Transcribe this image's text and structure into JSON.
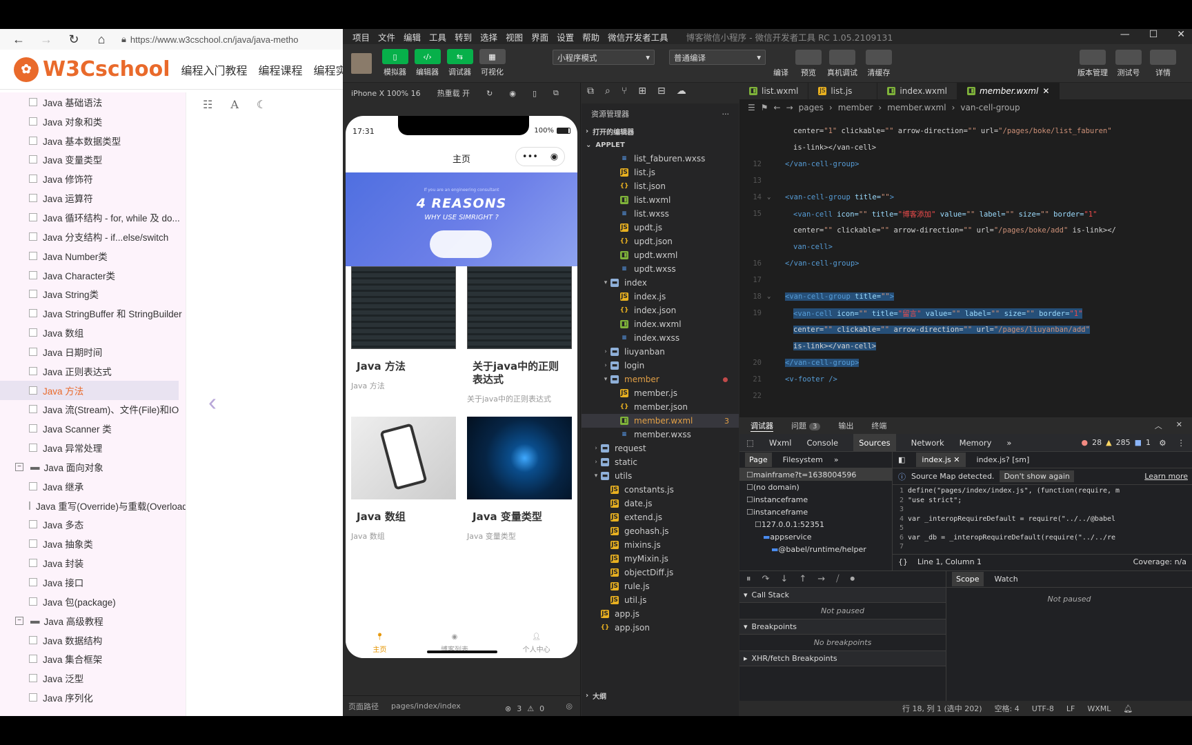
{
  "browser": {
    "url": "https://www.w3cschool.cn/java/java-metho",
    "logo_text": "W3Cschool",
    "nav": [
      "编程入门教程",
      "编程课程",
      "编程实战"
    ],
    "sidebar": [
      {
        "label": "Java 基础语法",
        "level": 1
      },
      {
        "label": "Java 对象和类",
        "level": 1
      },
      {
        "label": "Java 基本数据类型",
        "level": 1
      },
      {
        "label": "Java 变量类型",
        "level": 1
      },
      {
        "label": "Java 修饰符",
        "level": 1
      },
      {
        "label": "Java 运算符",
        "level": 1
      },
      {
        "label": "Java 循环结构 - for, while 及 do...",
        "level": 1
      },
      {
        "label": "Java 分支结构 - if...else/switch",
        "level": 1
      },
      {
        "label": "Java Number类",
        "level": 1
      },
      {
        "label": "Java Character类",
        "level": 1
      },
      {
        "label": "Java String类",
        "level": 1
      },
      {
        "label": "Java StringBuffer 和 StringBuilder",
        "level": 1
      },
      {
        "label": "Java 数组",
        "level": 1
      },
      {
        "label": "Java 日期时间",
        "level": 1
      },
      {
        "label": "Java 正则表达式",
        "level": 1
      },
      {
        "label": "Java 方法",
        "level": 1,
        "active": true
      },
      {
        "label": "Java 流(Stream)、文件(File)和IO",
        "level": 1
      },
      {
        "label": "Java Scanner 类",
        "level": 1
      },
      {
        "label": "Java 异常处理",
        "level": 1
      },
      {
        "label": "Java 面向对象",
        "level": 0
      },
      {
        "label": "Java 继承",
        "level": 1
      },
      {
        "label": "Java 重写(Override)与重载(Overload)",
        "level": 1
      },
      {
        "label": "Java 多态",
        "level": 1
      },
      {
        "label": "Java 抽象类",
        "level": 1
      },
      {
        "label": "Java 封装",
        "level": 1
      },
      {
        "label": "Java 接口",
        "level": 1
      },
      {
        "label": "Java 包(package)",
        "level": 1
      },
      {
        "label": "Java 高级教程",
        "level": 0
      },
      {
        "label": "Java 数据结构",
        "level": 1
      },
      {
        "label": "Java 集合框架",
        "level": 1
      },
      {
        "label": "Java 泛型",
        "level": 1
      },
      {
        "label": "Java 序列化",
        "level": 1
      }
    ]
  },
  "devtools": {
    "menu": [
      "项目",
      "文件",
      "编辑",
      "工具",
      "转到",
      "选择",
      "视图",
      "界面",
      "设置",
      "帮助",
      "微信开发者工具"
    ],
    "window_title": "博客微信小程序 - 微信开发者工具 RC 1.05.2109131",
    "toolbar": {
      "buttons": [
        "模拟器",
        "编辑器",
        "调试器",
        "可视化"
      ],
      "mode_select": "小程序模式",
      "compile_select": "普通编译",
      "actions": [
        "编译",
        "预览",
        "真机调试",
        "清缓存"
      ],
      "right_actions": [
        "版本管理",
        "测试号",
        "详情"
      ]
    },
    "simulator": {
      "device": "iPhone X 100% 16",
      "hot_reload": "热重载 开",
      "time": "17:31",
      "battery": "100%",
      "page_title": "主页",
      "banner_small": "If you are an engineering consultant",
      "banner_big": "4 REASONS",
      "banner_sub": "WHY USE SIMRIGHT ?",
      "cards": [
        {
          "title": "Java 方法",
          "sub": "Java 方法"
        },
        {
          "title": "关于java中的正则表达式",
          "sub": "关于java中的正则表达式"
        },
        {
          "title": "Java 数组",
          "sub": "Java 数组"
        },
        {
          "title": "Java 变量类型",
          "sub": "Java 变量类型"
        }
      ],
      "tabs": [
        "主页",
        "博客列表",
        "个人中心"
      ],
      "page_path_label": "页面路径",
      "page_path": "pages/index/index",
      "errors": "3",
      "warnings": "0"
    },
    "explorer": {
      "title": "资源管理器",
      "open_editors": "打开的编辑器",
      "project": "APPLET",
      "outline": "大纲",
      "files": [
        {
          "name": "list_faburen.wxss",
          "type": "wxss",
          "indent": 2
        },
        {
          "name": "list.js",
          "type": "js",
          "indent": 2
        },
        {
          "name": "list.json",
          "type": "json",
          "indent": 2
        },
        {
          "name": "list.wxml",
          "type": "wxml",
          "indent": 2
        },
        {
          "name": "list.wxss",
          "type": "wxss",
          "indent": 2
        },
        {
          "name": "updt.js",
          "type": "js",
          "indent": 2
        },
        {
          "name": "updt.json",
          "type": "json",
          "indent": 2
        },
        {
          "name": "updt.wxml",
          "type": "wxml",
          "indent": 2
        },
        {
          "name": "updt.wxss",
          "type": "wxss",
          "indent": 2
        },
        {
          "name": "index",
          "type": "folder",
          "indent": 1,
          "open": true
        },
        {
          "name": "index.js",
          "type": "js",
          "indent": 2
        },
        {
          "name": "index.json",
          "type": "json",
          "indent": 2
        },
        {
          "name": "index.wxml",
          "type": "wxml",
          "indent": 2
        },
        {
          "name": "index.wxss",
          "type": "wxss",
          "indent": 2
        },
        {
          "name": "liuyanban",
          "type": "folder",
          "indent": 1
        },
        {
          "name": "login",
          "type": "folder",
          "indent": 1
        },
        {
          "name": "member",
          "type": "folder",
          "indent": 1,
          "open": true,
          "orange": true,
          "dot": true
        },
        {
          "name": "member.js",
          "type": "js",
          "indent": 2
        },
        {
          "name": "member.json",
          "type": "json",
          "indent": 2
        },
        {
          "name": "member.wxml",
          "type": "wxml",
          "indent": 2,
          "selected": true,
          "orange": true,
          "badge": "3"
        },
        {
          "name": "member.wxss",
          "type": "wxss",
          "indent": 2
        },
        {
          "name": "request",
          "type": "folder",
          "indent": 0
        },
        {
          "name": "static",
          "type": "folder",
          "indent": 0
        },
        {
          "name": "utils",
          "type": "folder",
          "indent": 0,
          "open": true
        },
        {
          "name": "constants.js",
          "type": "js",
          "indent": 1
        },
        {
          "name": "date.js",
          "type": "js",
          "indent": 1
        },
        {
          "name": "extend.js",
          "type": "js",
          "indent": 1
        },
        {
          "name": "geohash.js",
          "type": "js",
          "indent": 1
        },
        {
          "name": "mixins.js",
          "type": "js",
          "indent": 1
        },
        {
          "name": "myMixin.js",
          "type": "js",
          "indent": 1
        },
        {
          "name": "objectDiff.js",
          "type": "js",
          "indent": 1
        },
        {
          "name": "rule.js",
          "type": "js",
          "indent": 1
        },
        {
          "name": "util.js",
          "type": "js",
          "indent": 1
        },
        {
          "name": "app.js",
          "type": "js",
          "indent": 0
        },
        {
          "name": "app.json",
          "type": "json",
          "indent": 0
        }
      ]
    },
    "editor": {
      "tabs": [
        {
          "name": "list.wxml",
          "type": "wxml"
        },
        {
          "name": "list.js",
          "type": "js"
        },
        {
          "name": "index.wxml",
          "type": "wxml"
        },
        {
          "name": "member.wxml",
          "type": "wxml",
          "active": true
        }
      ],
      "breadcrumb": [
        "pages",
        "member",
        "member.wxml",
        "van-cell-group"
      ],
      "lines": [
        {
          "n": "",
          "html": "<span class='tx'>center=</span><span class='st'>\"1\"</span><span class='tx'> clickable=</span><span class='st'>\"\"</span><span class='tx'> arrow-direction=</span><span class='st'>\"\"</span><span class='tx'> url=</span><span class='st'>\"/pages/boke/list_faburen\"</span>",
          "indent": 4
        },
        {
          "n": "",
          "html": "<span class='tx'>is-link&gt;&lt;/van-cell&gt;</span>",
          "indent": 4
        },
        {
          "n": "12",
          "html": "<span class='tg'>&lt;/van-cell-group&gt;</span>",
          "indent": 2
        },
        {
          "n": "13",
          "html": "",
          "indent": 0
        },
        {
          "n": "14",
          "html": "<span class='tg'>&lt;van-cell-group</span><span class='at'> title=</span><span class='st'>\"\"</span><span class='tg'>&gt;</span>",
          "indent": 2,
          "fold": true
        },
        {
          "n": "15",
          "html": "<span class='tg'>&lt;van-cell</span><span class='at'> icon=</span><span class='st'>\"\"</span><span class='at'> title=</span><span class='red'>\"博客添加\"</span><span class='at'> value=</span><span class='st'>\"\"</span><span class='at'> label=</span><span class='st'>\"\"</span><span class='at'> size=</span><span class='st'>\"\"</span><span class='at'> border=</span><span class='red'>\"1\"</span>",
          "indent": 4
        },
        {
          "n": "",
          "html": "<span class='tx'>center=</span><span class='st'>\"\"</span><span class='tx'> clickable=</span><span class='st'>\"\"</span><span class='tx'> arrow-direction=</span><span class='st'>\"\"</span><span class='tx'> url=</span><span class='st'>\"/pages/boke/add\"</span><span class='tx'> is-link&gt;&lt;/</span>",
          "indent": 4
        },
        {
          "n": "",
          "html": "<span class='tg'>van-cell&gt;</span>",
          "indent": 4
        },
        {
          "n": "16",
          "html": "<span class='tg'>&lt;/van-cell-group&gt;</span>",
          "indent": 2
        },
        {
          "n": "17",
          "html": "",
          "indent": 0
        },
        {
          "n": "18",
          "html": "<span class='tg'>&lt;van-cell-group</span><span class='at'> title=</span><span class='st'>\"\"</span><span class='tg'>&gt;</span>",
          "indent": 2,
          "fold": true,
          "hl": true
        },
        {
          "n": "19",
          "html": "<span class='tg'>&lt;van-cell</span><span class='at'> icon=</span><span class='st'>\"\"</span><span class='at'> title=</span><span class='red'>\"留言\"</span><span class='at'> value=</span><span class='st'>\"\"</span><span class='at'> label=</span><span class='st'>\"\"</span><span class='at'> size=</span><span class='st'>\"\"</span><span class='at'> border=</span><span class='red'>\"1\"</span>",
          "indent": 4,
          "hl": true
        },
        {
          "n": "",
          "html": "<span class='tx'>center=</span><span class='st'>\"\"</span><span class='tx'> clickable=</span><span class='st'>\"\"</span><span class='tx'> arrow-direction=</span><span class='st'>\"\"</span><span class='tx'> url=</span><span class='st'>\"/pages/liuyanban/add\"</span>",
          "indent": 4,
          "hl": true
        },
        {
          "n": "",
          "html": "<span class='tx'>is-link&gt;&lt;/van-cell&gt;</span>",
          "indent": 4,
          "hl": true
        },
        {
          "n": "20",
          "html": "<span class='tg'>&lt;/van-cell-group&gt;</span>",
          "indent": 2,
          "hl": true
        },
        {
          "n": "21",
          "html": "<span class='tg'>&lt;v-footer /&gt;</span>",
          "indent": 2
        },
        {
          "n": "22",
          "html": "",
          "indent": 0
        }
      ]
    },
    "debugger": {
      "tabs": [
        "调试器",
        "问题",
        "输出",
        "终端"
      ],
      "problems_count": "3",
      "cdt_tabs": [
        "Wxml",
        "Console",
        "Sources",
        "Network",
        "Memory"
      ],
      "errors": "28",
      "warnings": "285",
      "infos": "1",
      "nav_tabs": [
        "Page",
        "Filesystem"
      ],
      "tree": [
        {
          "label": "mainframe?t=1638004596",
          "depth": 0,
          "sel": true
        },
        {
          "label": "(no domain)",
          "depth": 0
        },
        {
          "label": "instanceframe",
          "depth": 0
        },
        {
          "label": "instanceframe",
          "depth": 0
        },
        {
          "label": "127.0.0.1:52351",
          "depth": 1
        },
        {
          "label": "appservice",
          "depth": 2
        },
        {
          "label": "@babel/runtime/helper",
          "depth": 3
        }
      ],
      "file_tabs": [
        "index.js",
        "index.js? [sm]"
      ],
      "source_map": "Source Map detected.",
      "dont_show": "Don't show again",
      "learn_more": "Learn more",
      "code": [
        {
          "n": "1",
          "t": "define(\"pages/index/index.js\", (function(require, m"
        },
        {
          "n": "2",
          "t": "\"use strict\";"
        },
        {
          "n": "3",
          "t": ""
        },
        {
          "n": "4",
          "t": "var _interopRequireDefault = require(\"../../@babel"
        },
        {
          "n": "5",
          "t": ""
        },
        {
          "n": "6",
          "t": "var _db = _interopRequireDefault(require(\"../../re"
        },
        {
          "n": "7",
          "t": ""
        }
      ],
      "position": "Line 1, Column 1",
      "coverage": "Coverage: n/a",
      "call_stack": "Call Stack",
      "not_paused": "Not paused",
      "breakpoints": "Breakpoints",
      "no_breakpoints": "No breakpoints",
      "xhr": "XHR/fetch Breakpoints",
      "scope_tabs": [
        "Scope",
        "Watch"
      ]
    },
    "statusbar": {
      "cursor": "行 18, 列 1 (选中 202)",
      "spaces": "空格: 4",
      "encoding": "UTF-8",
      "eol": "LF",
      "lang": "WXML"
    }
  }
}
